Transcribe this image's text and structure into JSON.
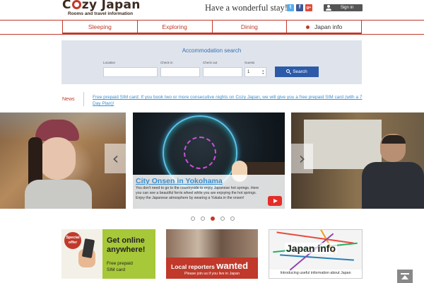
{
  "header": {
    "logo_title_pre": "C",
    "logo_title_post": "zy Japan",
    "logo_subtitle": "Rooms and travel information",
    "tagline": "Have a wonderful stay!",
    "social": {
      "twitter": "t",
      "facebook": "f",
      "googleplus": "g+"
    },
    "signin_label": "Sign in"
  },
  "nav": {
    "items": [
      {
        "label": "Sleeping"
      },
      {
        "label": "Exploring"
      },
      {
        "label": "Dining"
      },
      {
        "label": "Japan info"
      }
    ]
  },
  "search": {
    "title": "Accommodation search",
    "location_label": "Location",
    "checkin_label": "Check in",
    "checkout_label": "Check out",
    "guests_label": "Guests",
    "guests_value": "1",
    "button_label": "Search"
  },
  "news": {
    "label": "News",
    "text": "Free prepaid SIM card: If you book two or more consecutive nights on Cozy Japan, we will give you a free prepaid SIM card (with a 7 Day Plan)!"
  },
  "slider": {
    "caption_title": "City Onsen in Yokohama",
    "caption_body": "You don't need to go to the countryside to enjoy Japanese hot springs. Here you can see a beautiful ferris wheel while you are enjoying the hot springs. Enjoy the Japanese atmosphere by wearing a Yukata in the onsen!",
    "dot_count": 5,
    "active_dot": 3
  },
  "banners": {
    "sim": {
      "badge": "Special offer",
      "head_line1": "Get online",
      "head_line2": "anywhere!",
      "sub_line1": "Free prepaid",
      "sub_line2": "SIM card"
    },
    "reporters": {
      "title_word1": "Local reporters",
      "title_word2": "wanted",
      "sub": "Please join us if you live in Japan"
    },
    "japan_info": {
      "title": "Japan info",
      "sub": "Introducing useful information about Japan"
    }
  },
  "colors": {
    "brand_red": "#c0392b",
    "link_blue": "#3a8fd0",
    "search_blue": "#2d5aa8",
    "panel_bg": "#dfe4ec"
  },
  "icons": [
    "twitter-icon",
    "facebook-icon",
    "googleplus-icon",
    "user-icon",
    "search-icon",
    "chevron-left-icon",
    "chevron-right-icon",
    "youtube-icon",
    "back-to-top-icon",
    "japan-flag-icon"
  ]
}
